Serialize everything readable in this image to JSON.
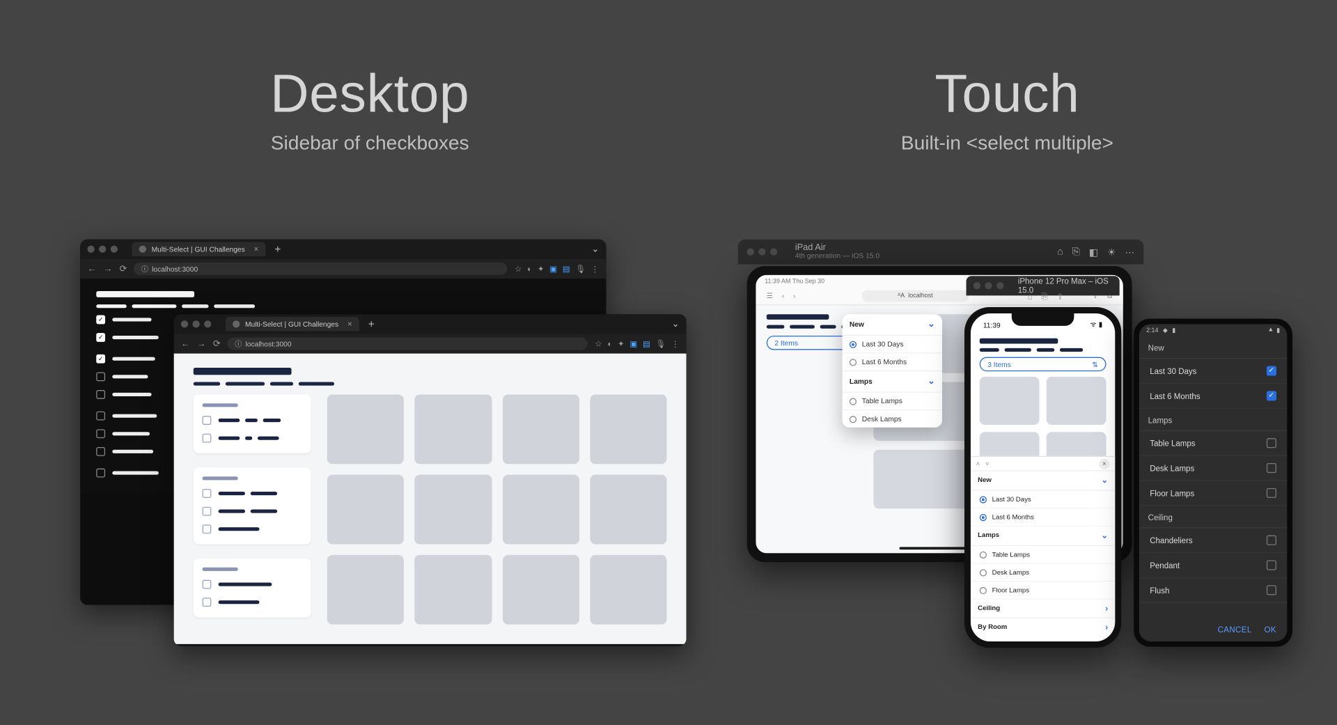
{
  "headings": {
    "desktop": {
      "title": "Desktop",
      "subtitle": "Sidebar of checkboxes"
    },
    "touch": {
      "title": "Touch",
      "subtitle": "Built-in <select multiple>"
    }
  },
  "browser": {
    "tab_title": "Multi-Select | GUI Challenges",
    "url": "localhost:3000",
    "url_prefix": "ⓘ"
  },
  "simulator": {
    "ipad": {
      "name": "iPad Air",
      "detail": "4th generation — iOS 15.0"
    },
    "iphone": {
      "name": "iPhone 12 Pro Max – iOS 15.0"
    }
  },
  "ipad": {
    "status_left": "11:39 AM  Thu Sep 30",
    "url_label": "localhost",
    "selected_label": "2 Items"
  },
  "iphone": {
    "time": "11:39",
    "selected_label": "3 Items"
  },
  "android": {
    "time": "2:14",
    "actions": {
      "cancel": "CANCEL",
      "ok": "OK"
    }
  },
  "select_groups": {
    "new": {
      "label": "New",
      "items": [
        "Last 30 Days",
        "Last 6 Months"
      ]
    },
    "lamps": {
      "label": "Lamps",
      "items": [
        "Table Lamps",
        "Desk Lamps",
        "Floor Lamps"
      ]
    },
    "ceiling": {
      "label": "Ceiling",
      "items": [
        "Chandeliers",
        "Pendant",
        "Flush"
      ]
    },
    "byroom": {
      "label": "By Room"
    }
  },
  "ipad_popover_selection": {
    "new": [
      true,
      false
    ],
    "lamps": [
      false,
      false
    ]
  },
  "iphone_sheet_selection": {
    "new": [
      true,
      true
    ]
  },
  "android_selection": {
    "new": [
      true,
      true
    ],
    "lamps": [
      false,
      false,
      false
    ],
    "ceiling": [
      false,
      false,
      false
    ]
  }
}
